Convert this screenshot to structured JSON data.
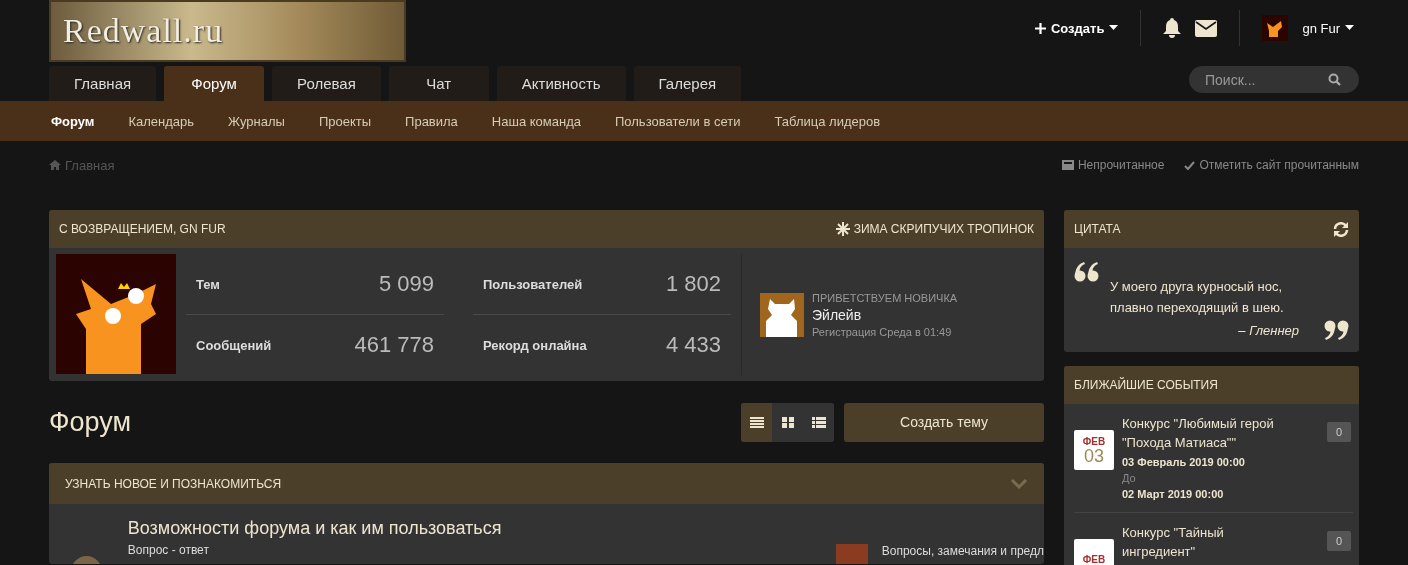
{
  "logo": {
    "text": "Redwall.ru"
  },
  "header": {
    "create_label": "Создать",
    "user_name": "gn Fur"
  },
  "search": {
    "placeholder": "Поиск..."
  },
  "tabs": [
    {
      "label": "Главная",
      "selected": false
    },
    {
      "label": "Форум",
      "selected": true
    },
    {
      "label": "Ролевая",
      "selected": false
    },
    {
      "label": "Чат",
      "selected": false
    },
    {
      "label": "Активность",
      "selected": false
    },
    {
      "label": "Галерея",
      "selected": false
    }
  ],
  "subnav": [
    {
      "label": "Форум",
      "selected": true
    },
    {
      "label": "Календарь",
      "selected": false
    },
    {
      "label": "Журналы",
      "selected": false
    },
    {
      "label": "Проекты",
      "selected": false
    },
    {
      "label": "Правила",
      "selected": false
    },
    {
      "label": "Наша команда",
      "selected": false
    },
    {
      "label": "Пользователи в сети",
      "selected": false
    },
    {
      "label": "Таблица лидеров",
      "selected": false
    }
  ],
  "breadcrumb": {
    "home": "Главная",
    "links": [
      "Непрочитанное",
      "Отметить сайт прочитанным"
    ]
  },
  "welcome": {
    "title": "С ВОЗВРАЩЕНИЕМ, GN FUR",
    "season": "ЗИМА СКРИПУЧИХ ТРОПИНОК",
    "stats": [
      {
        "label": "Тем",
        "value": "5 099"
      },
      {
        "label": "Пользователей",
        "value": "1 802"
      },
      {
        "label": "Сообщений",
        "value": "461 778"
      },
      {
        "label": "Рекорд онлайна",
        "value": "4 433"
      }
    ],
    "newcomer": {
      "heading": "ПРИВЕТСТВУЕМ НОВИЧКА",
      "name": "Эйлейв",
      "registered": "Регистрация Среда в 01:49"
    }
  },
  "page_title": "Форум",
  "view_toggles": [
    {
      "selected": true
    },
    {
      "selected": false
    },
    {
      "selected": false
    }
  ],
  "new_topic_button": "Создать тему",
  "category": {
    "title": "УЗНАТЬ НОВОЕ И ПОЗНАКОМИТЬСЯ",
    "expanded": true,
    "forums": [
      {
        "title": "Возможности форума и как им пользоваться",
        "subforum": "Вопрос - ответ",
        "last_post": "Вопросы, замечания и предл"
      }
    ]
  },
  "quote": {
    "title": "ЦИТАТА",
    "text": "У моего друга курносый нос, плавно переходящий в шею.",
    "author": "– Гленнер"
  },
  "events": {
    "title": "БЛИЖАЙШИЕ СОБЫТИЯ",
    "items": [
      {
        "title": "Конкурс \"Любимый герой \"Похода Матиаса\"\"",
        "month": "ФЕВ",
        "day": "03",
        "start": "03 Февраль 2019 00:00",
        "until": "До",
        "end": "02 Март 2019 00:00",
        "comments": "0"
      },
      {
        "title": "Конкурс \"Тайный ингредиент\"",
        "month": "ФЕВ",
        "comments": "0"
      }
    ]
  }
}
